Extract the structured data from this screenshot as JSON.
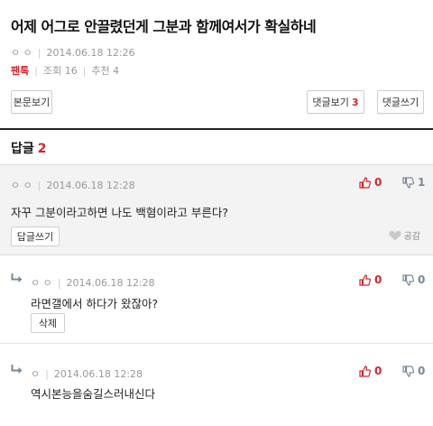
{
  "post": {
    "title": "어제 어그로 안끌렸던게 그분과 함께여서가 확실하네",
    "author": "ㅇ ㅇ",
    "date": "2014.06.18 12:26",
    "board": "팬톡",
    "views": "조회 16",
    "recommends": "추천 4"
  },
  "actions": {
    "body_view": "본문보기",
    "comment_view": "댓글보기",
    "comment_count": "3",
    "comment_write": "댓글쓰기"
  },
  "replies_header": {
    "label": "답글",
    "count": "2"
  },
  "comments": [
    {
      "author": "ㅇ ㅇ",
      "date": "2014.06.18 12:28",
      "text": "자꾸 그분이라고하면 나도 백혐이라고 부른다?",
      "up": "0",
      "down": "1",
      "reply_button": "답글쓰기",
      "empathy": "공감"
    },
    {
      "author": "ㅇ ㅇ",
      "date": "2014.06.18 12:28",
      "text": "라면갤에서 하다가 왔잖아?",
      "up": "0",
      "down": "0",
      "delete_button": "삭제"
    },
    {
      "author": "ㅇ",
      "date": "2014.06.18 12:28",
      "text": "역시본능을숨길스러내신다",
      "up": "0",
      "down": "0"
    }
  ],
  "colors": {
    "accent": "#d0262c",
    "muted": "#999999",
    "down": "#7a8896"
  }
}
